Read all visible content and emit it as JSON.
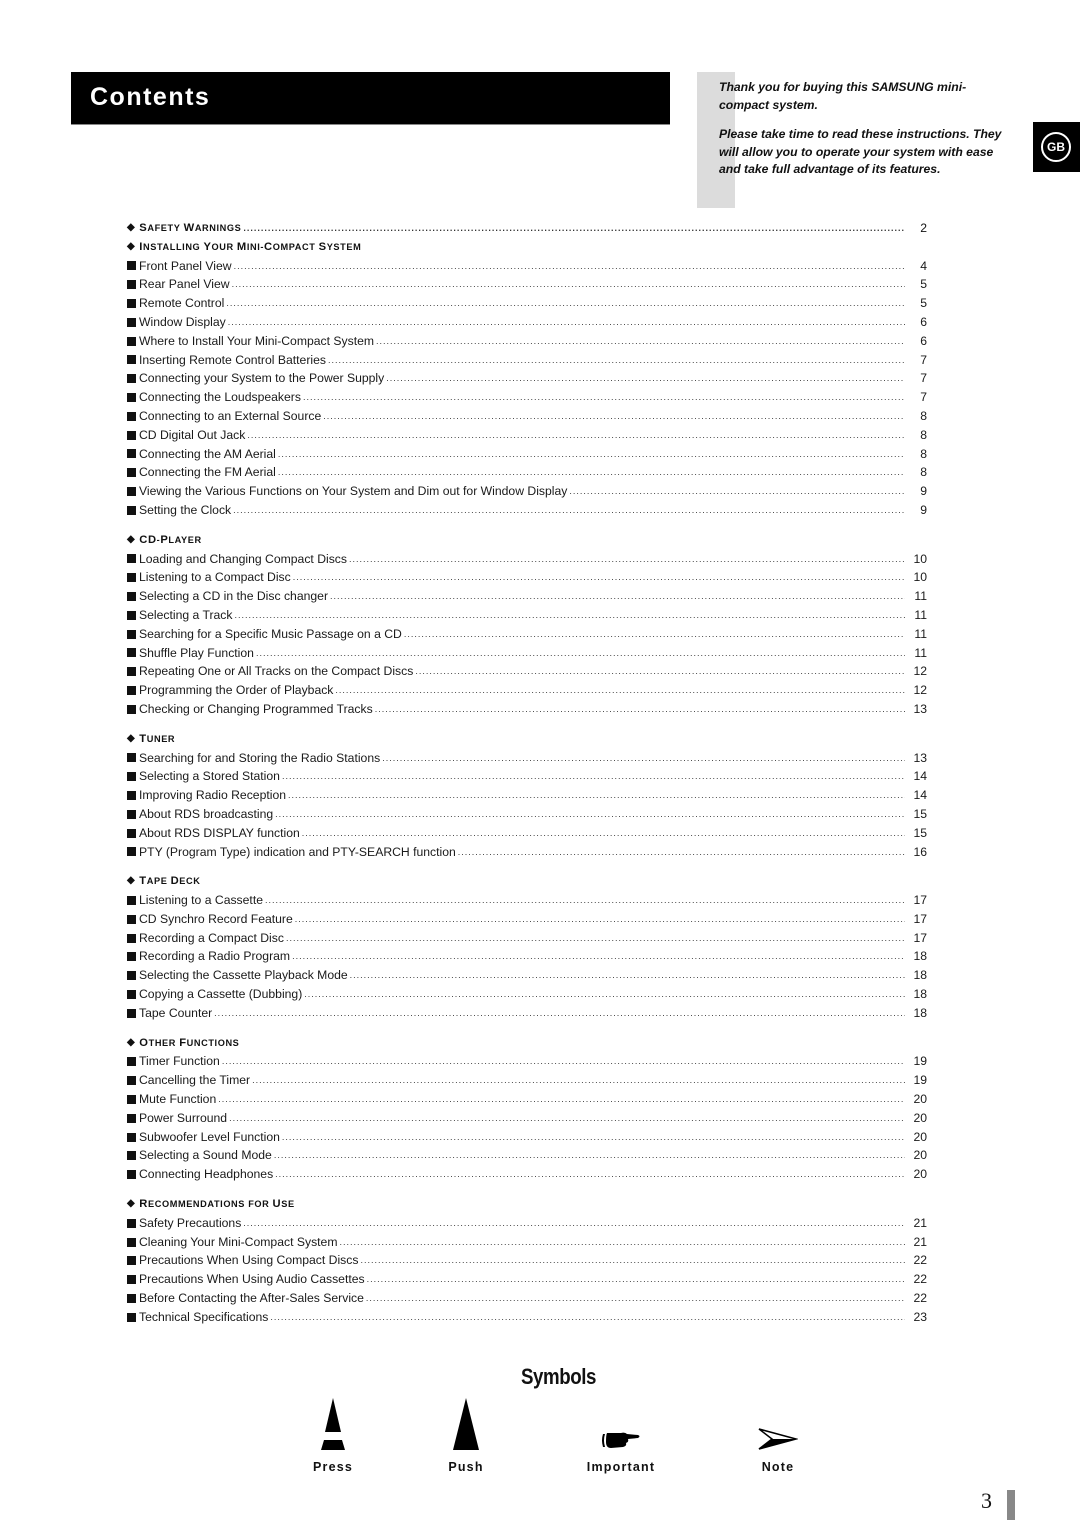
{
  "header": {
    "title": "Contents",
    "lang_badge": "GB"
  },
  "intro": {
    "line1": "Thank you for buying this SAMSUNG mini-compact system.",
    "line2": "Please take time to read these instructions. They will allow you to operate your system with ease and take full advantage of its features."
  },
  "toc": [
    {
      "section": "Safety Warnings",
      "page": "2",
      "items": []
    },
    {
      "section": "Installing Your Mini-Compact System",
      "page": "",
      "items": [
        {
          "label": "Front Panel View",
          "page": "4"
        },
        {
          "label": "Rear Panel View",
          "page": "5"
        },
        {
          "label": "Remote Control",
          "page": "5"
        },
        {
          "label": "Window Display",
          "page": "6"
        },
        {
          "label": "Where to Install Your Mini-Compact System",
          "page": "6"
        },
        {
          "label": "Inserting Remote Control Batteries",
          "page": "7"
        },
        {
          "label": "Connecting your System to the Power Supply",
          "page": "7"
        },
        {
          "label": "Connecting the Loudspeakers",
          "page": "7"
        },
        {
          "label": "Connecting to an External Source",
          "page": "8"
        },
        {
          "label": "CD Digital Out Jack",
          "page": "8"
        },
        {
          "label": "Connecting the AM Aerial",
          "page": "8"
        },
        {
          "label": "Connecting the FM Aerial",
          "page": "8"
        },
        {
          "label": "Viewing the Various Functions on Your System and Dim out for Window Display",
          "page": "9"
        },
        {
          "label": "Setting the Clock",
          "page": "9"
        }
      ]
    },
    {
      "section": "CD-Player",
      "page": "",
      "items": [
        {
          "label": "Loading and Changing Compact Discs",
          "page": "10"
        },
        {
          "label": "Listening to a Compact Disc",
          "page": "10"
        },
        {
          "label": "Selecting a CD in the Disc changer",
          "page": "11"
        },
        {
          "label": "Selecting a Track",
          "page": "11"
        },
        {
          "label": "Searching for a Specific Music Passage on a CD",
          "page": "11"
        },
        {
          "label": "Shuffle Play Function",
          "page": "11"
        },
        {
          "label": "Repeating One or All Tracks on the Compact Discs",
          "page": "12"
        },
        {
          "label": "Programming the Order of Playback",
          "page": "12"
        },
        {
          "label": "Checking or Changing Programmed Tracks",
          "page": "13"
        }
      ]
    },
    {
      "section": "Tuner",
      "page": "",
      "items": [
        {
          "label": "Searching for and Storing the Radio Stations",
          "page": "13"
        },
        {
          "label": "Selecting a Stored Station",
          "page": "14"
        },
        {
          "label": "Improving Radio Reception",
          "page": "14"
        },
        {
          "label": "About RDS broadcasting",
          "page": "15"
        },
        {
          "label": "About RDS DISPLAY function",
          "page": "15"
        },
        {
          "label": "PTY (Program Type) indication and PTY-SEARCH function",
          "page": "16"
        }
      ]
    },
    {
      "section": "Tape Deck",
      "page": "",
      "items": [
        {
          "label": "Listening to a Cassette",
          "page": "17"
        },
        {
          "label": "CD Synchro Record Feature",
          "page": "17"
        },
        {
          "label": "Recording a Compact Disc",
          "page": "17"
        },
        {
          "label": "Recording a Radio Program",
          "page": "18"
        },
        {
          "label": "Selecting the Cassette Playback Mode",
          "page": "18"
        },
        {
          "label": "Copying a Cassette (Dubbing)",
          "page": "18"
        },
        {
          "label": "Tape Counter",
          "page": "18"
        }
      ]
    },
    {
      "section": "Other Functions",
      "page": "",
      "items": [
        {
          "label": "Timer Function",
          "page": "19"
        },
        {
          "label": "Cancelling the Timer",
          "page": "19"
        },
        {
          "label": "Mute Function",
          "page": "20"
        },
        {
          "label": "Power Surround",
          "page": "20"
        },
        {
          "label": "Subwoofer Level Function",
          "page": "20"
        },
        {
          "label": "Selecting a Sound Mode",
          "page": "20"
        },
        {
          "label": "Connecting Headphones",
          "page": "20"
        }
      ]
    },
    {
      "section": "Recommendations for Use",
      "page": "",
      "items": [
        {
          "label": "Safety Precautions",
          "page": "21"
        },
        {
          "label": "Cleaning Your Mini-Compact System",
          "page": "21"
        },
        {
          "label": "Precautions When Using Compact Discs",
          "page": "22"
        },
        {
          "label": "Precautions When Using Audio Cassettes",
          "page": "22"
        },
        {
          "label": "Before Contacting the After-Sales Service",
          "page": "22"
        },
        {
          "label": "Technical Specifications",
          "page": "23"
        }
      ]
    }
  ],
  "symbols": {
    "title": "Symbols",
    "items": [
      {
        "icon": "press-icon",
        "label": "Press"
      },
      {
        "icon": "push-icon",
        "label": "Push"
      },
      {
        "icon": "pointing-hand-icon",
        "label": "Important"
      },
      {
        "icon": "note-arrow-icon",
        "label": "Note"
      }
    ]
  },
  "footer": {
    "page_number": "3"
  }
}
